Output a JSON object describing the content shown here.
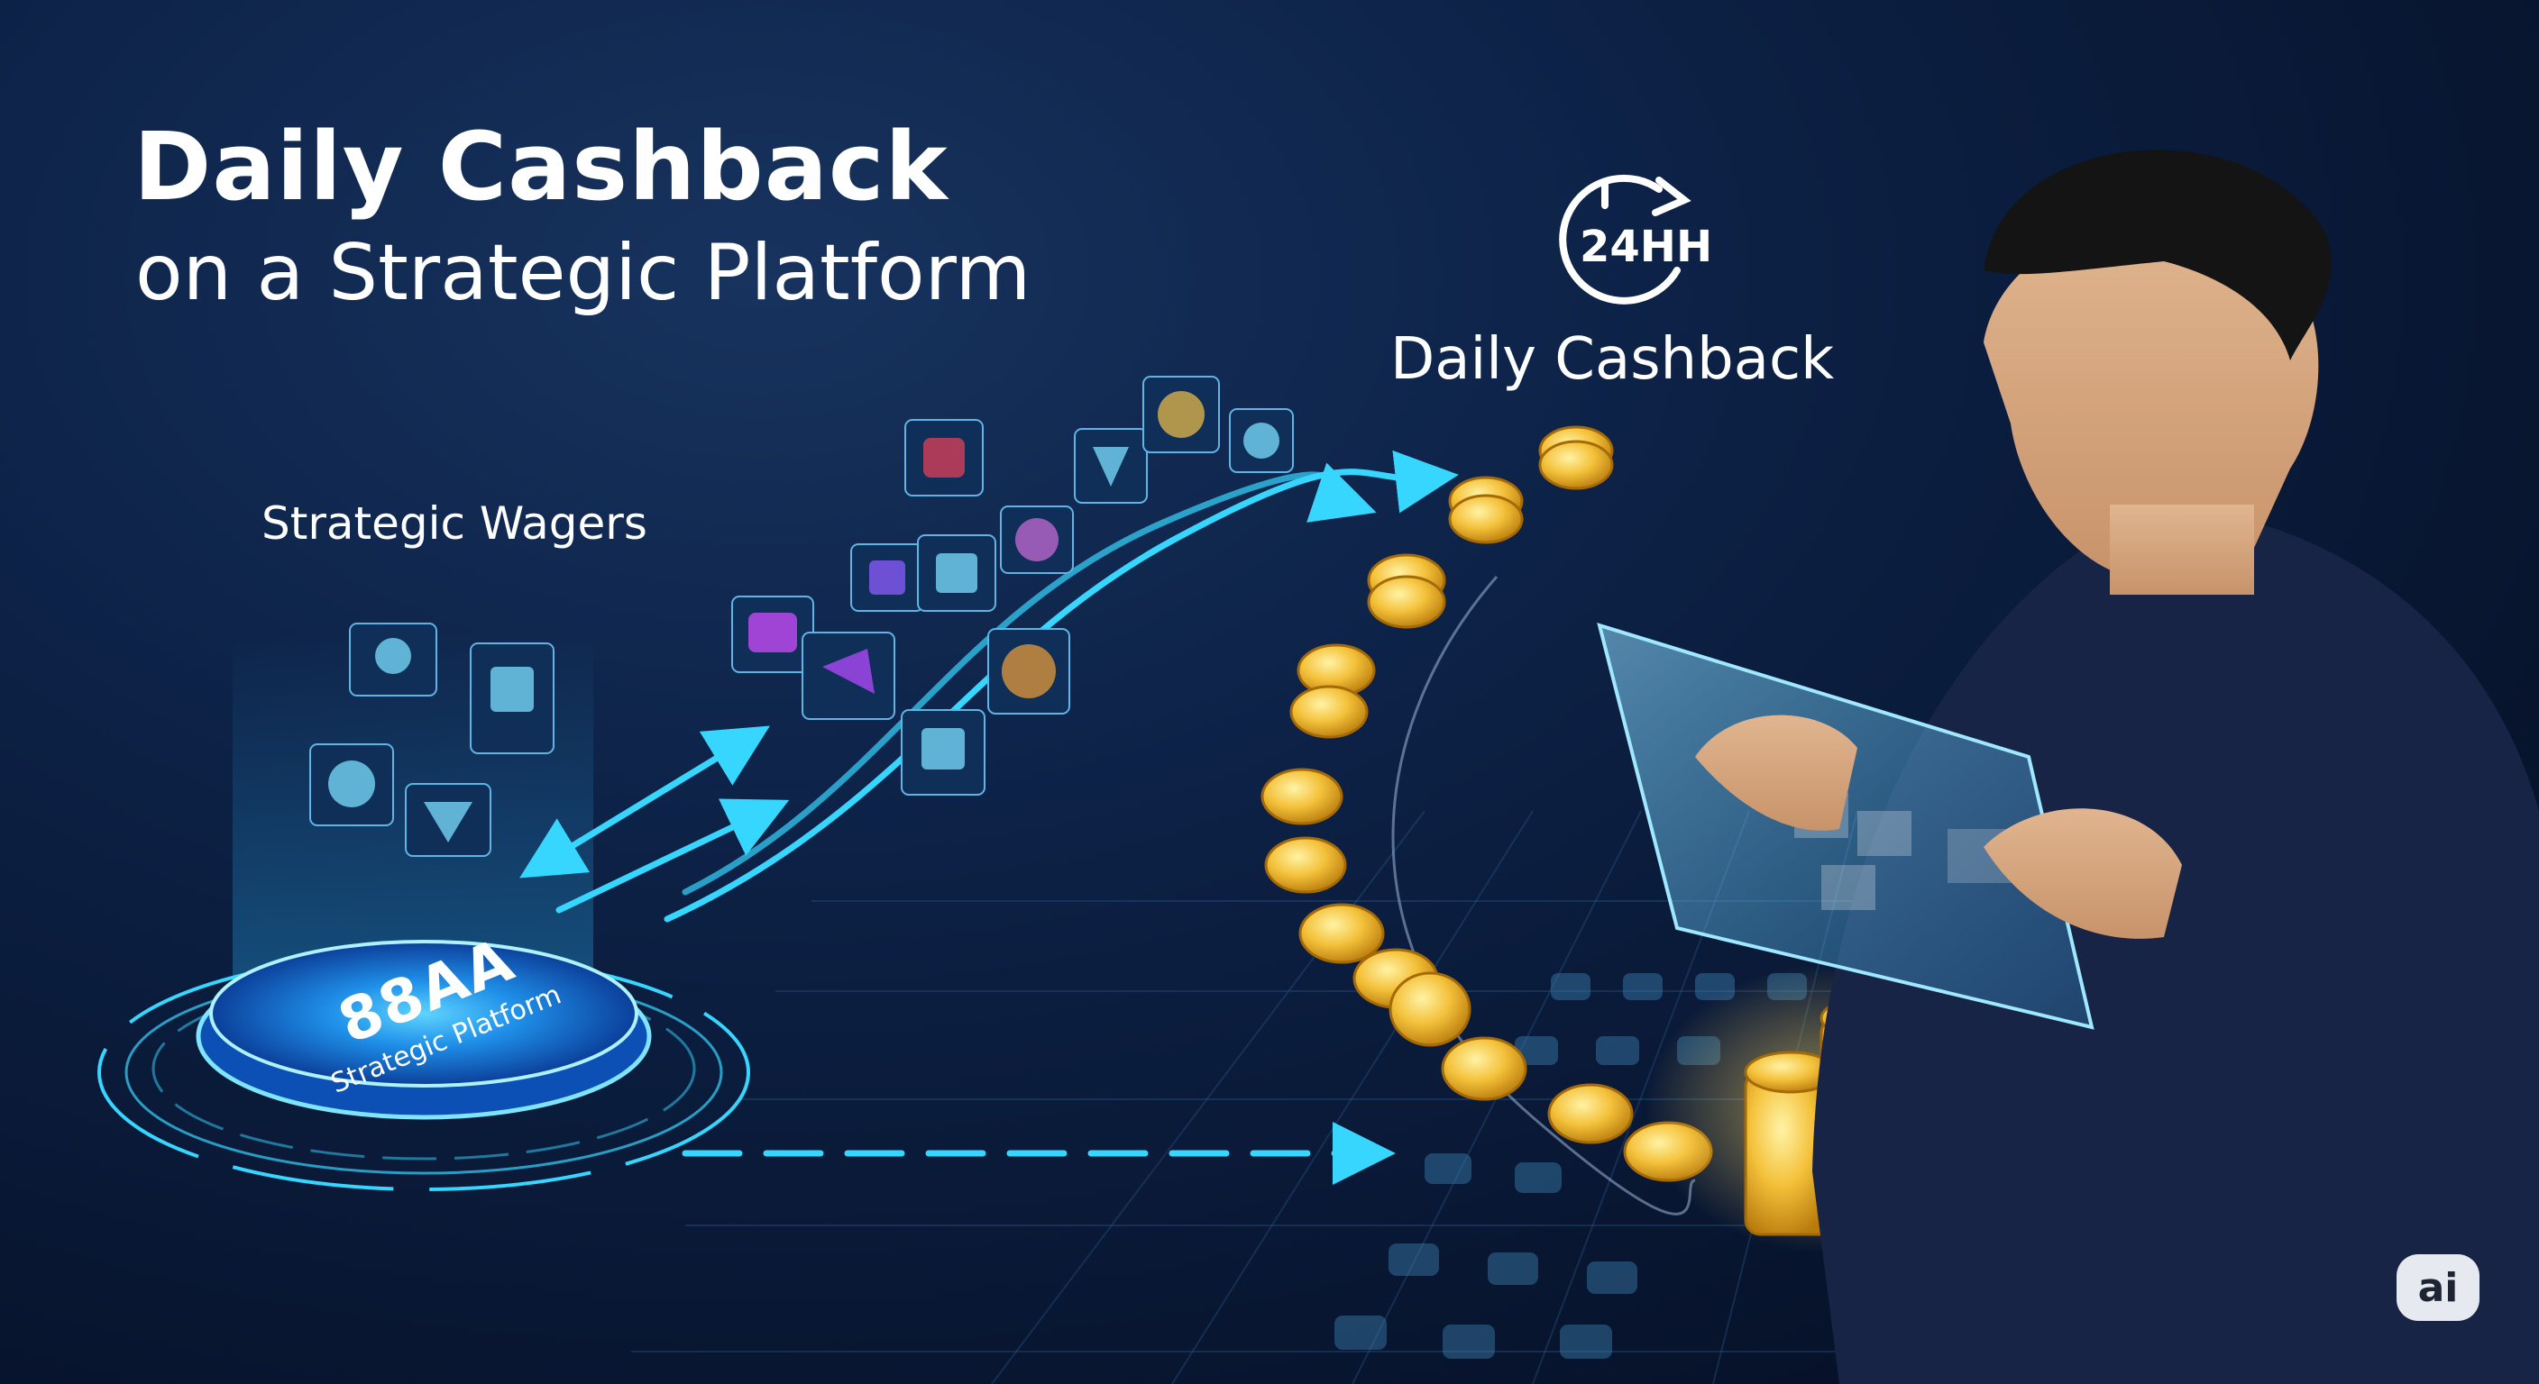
{
  "headline": {
    "title": "Daily Cashback",
    "subtitle": "on a Strategic Platform"
  },
  "platform": {
    "brand": "88AA",
    "caption": "Strategic Platform"
  },
  "labels": {
    "wagers": "Strategic Wagers",
    "cashback": "Daily Cashback",
    "clock": "24HH"
  },
  "badge": {
    "text": "ai"
  },
  "colors": {
    "accent_cyan": "#36d6ff",
    "coin_gold": "#f4c13a",
    "background_navy": "#0b1d3d"
  },
  "icons": [
    "game-tile-icon",
    "game-tile-icon",
    "game-tile-icon",
    "game-tile-icon",
    "game-tile-icon",
    "game-tile-icon",
    "game-tile-icon",
    "game-tile-icon",
    "game-tile-icon",
    "game-tile-icon",
    "game-tile-icon",
    "game-tile-icon",
    "game-tile-icon",
    "game-tile-icon",
    "game-tile-icon",
    "game-tile-icon"
  ]
}
